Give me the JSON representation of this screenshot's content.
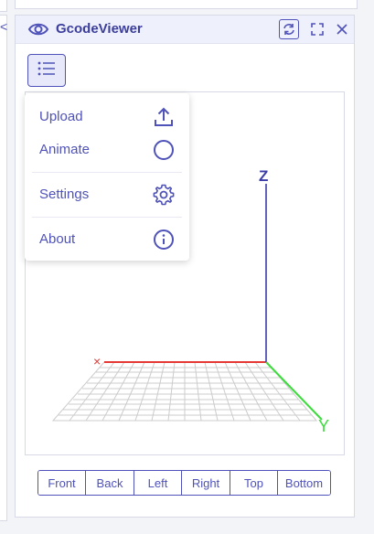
{
  "app": {
    "title": "GcodeViewer",
    "left_panel_glyph": "<"
  },
  "titlebar": {
    "icons": [
      "eye-icon",
      "refresh-icon",
      "fullscreen-icon",
      "close-icon"
    ]
  },
  "toolbar": {
    "menu_icon": "list-icon"
  },
  "menu": {
    "items": [
      {
        "label": "Upload",
        "icon": "upload-icon"
      },
      {
        "label": "Animate",
        "icon": "circle-icon"
      },
      {
        "label": "Settings",
        "icon": "gear-icon"
      },
      {
        "label": "About",
        "icon": "info-icon"
      }
    ]
  },
  "viewport": {
    "axis_z": "Z",
    "axis_y": "Y",
    "axis_x": "×"
  },
  "views": {
    "buttons": [
      "Front",
      "Back",
      "Left",
      "Right",
      "Top",
      "Bottom"
    ]
  },
  "colors": {
    "accent": "#4f52b8",
    "axis_x": "#e53935",
    "axis_y": "#3cdc3c",
    "axis_z": "#3a3da8",
    "grid": "#cccccc"
  }
}
